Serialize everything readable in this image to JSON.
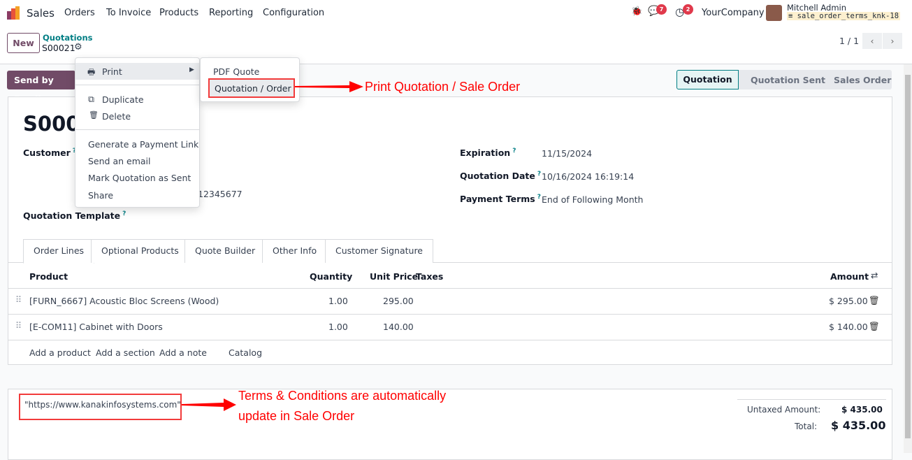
{
  "nav": {
    "app": "Sales",
    "menu": [
      "Orders",
      "To Invoice",
      "Products",
      "Reporting",
      "Configuration"
    ],
    "chat_count": "7",
    "activity_count": "2",
    "company": "YourCompany",
    "user": "Mitchell Admin",
    "database": "sale_order_terms_knk-18"
  },
  "control": {
    "new_label": "New",
    "breadcrumb": "Quotations",
    "record": "S00021",
    "pager": "1 / 1"
  },
  "actions": {
    "send_email": "Send by Email"
  },
  "statusbar": {
    "stages": [
      "Quotation",
      "Quotation Sent",
      "Sales Order"
    ],
    "active": "Quotation"
  },
  "action_menu": {
    "print": "Print",
    "duplicate": "Duplicate",
    "delete": "Delete",
    "items": [
      "Generate a Payment Link",
      "Send an email",
      "Mark Quotation as Sent",
      "Share"
    ]
  },
  "print_menu": {
    "items": [
      "PDF Quote",
      "Quotation / Order"
    ]
  },
  "form": {
    "title": "S0002",
    "customer_label": "Customer",
    "customer_partial": "12345677",
    "template_label": "Quotation Template",
    "expiration_label": "Expiration",
    "expiration": "11/15/2024",
    "date_label": "Quotation Date",
    "date": "10/16/2024 16:19:14",
    "terms_label": "Payment Terms",
    "terms": "End of Following Month"
  },
  "tabs": [
    "Order Lines",
    "Optional Products",
    "Quote Builder",
    "Other Info",
    "Customer Signature"
  ],
  "table": {
    "headers": {
      "product": "Product",
      "quantity": "Quantity",
      "unit_price": "Unit Price",
      "taxes": "Taxes",
      "amount": "Amount"
    },
    "rows": [
      {
        "product": "[FURN_6667] Acoustic Bloc Screens (Wood)",
        "quantity": "1.00",
        "unit_price": "295.00",
        "amount": "$ 295.00"
      },
      {
        "product": "[E-COM11] Cabinet with Doors",
        "quantity": "1.00",
        "unit_price": "140.00",
        "amount": "$ 140.00"
      }
    ],
    "add": [
      "Add a product",
      "Add a section",
      "Add a note",
      "Catalog"
    ]
  },
  "footer": {
    "terms_note": "\"https://www.kanakinfosystems.com\"",
    "untaxed_label": "Untaxed Amount:",
    "untaxed": "$ 435.00",
    "total_label": "Total:",
    "total": "$ 435.00"
  },
  "annotations": {
    "print": "Print Quotation / Sale Order",
    "terms_line1": "Terms & Conditions are automatically",
    "terms_line2": "update in Sale Order"
  },
  "colors": {
    "brand": "#714B67",
    "accent": "#017e84",
    "annotation": "#ff0000"
  }
}
